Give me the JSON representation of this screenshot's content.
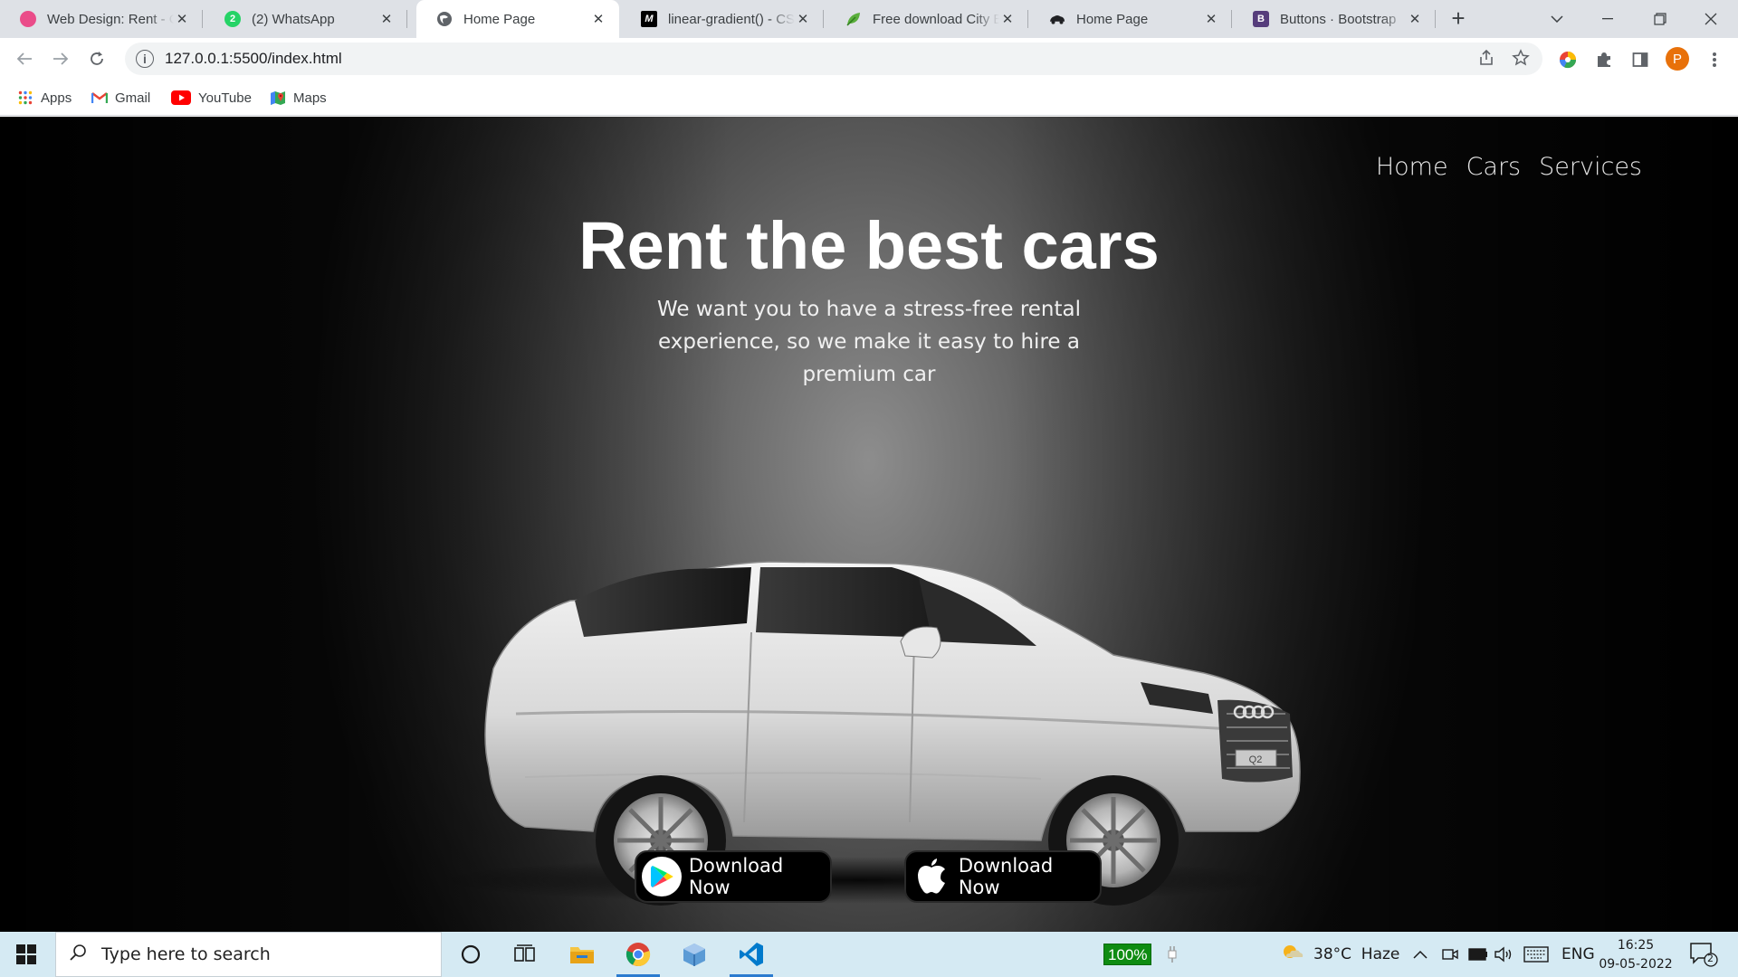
{
  "browser": {
    "tabs": [
      {
        "title": "Web Design: Rent - Car",
        "favicon": "dribbble-icon",
        "color": "#ea4c89"
      },
      {
        "title": "(2) WhatsApp",
        "favicon": "whatsapp-icon",
        "color": "#25d366",
        "badge": "2"
      },
      {
        "title": "Home Page",
        "favicon": "globe-icon",
        "color": "#5f6368",
        "active": true
      },
      {
        "title": "linear-gradient() - CSS",
        "favicon": "mdn-icon",
        "color": "#000000"
      },
      {
        "title": "Free download City Bike",
        "favicon": "leaf-icon",
        "color": "#4caf50"
      },
      {
        "title": "Home Page",
        "favicon": "car-icon",
        "color": "#202124"
      },
      {
        "title": "Buttons · Bootstrap",
        "favicon": "bootstrap-icon",
        "color": "#563d7c",
        "letter": "B"
      }
    ],
    "url": "127.0.0.1:5500/index.html",
    "profile_initial": "P",
    "bookmarks": [
      {
        "label": "Apps",
        "icon": "apps-grid-icon"
      },
      {
        "label": "Gmail",
        "icon": "gmail-icon"
      },
      {
        "label": "YouTube",
        "icon": "youtube-icon"
      },
      {
        "label": "Maps",
        "icon": "maps-icon"
      }
    ]
  },
  "page": {
    "nav": [
      "Home",
      "Cars",
      "Services"
    ],
    "title": "Rent the best cars",
    "subtitle": "We want you to have a stress-free rental experience, so we make it easy to hire a premium car",
    "car_plate": "Q2",
    "buttons": [
      {
        "label": "Download Now",
        "icon": "google-play-icon"
      },
      {
        "label": "Download Now",
        "icon": "apple-icon"
      }
    ]
  },
  "taskbar": {
    "search_placeholder": "Type here to search",
    "battery": "100%",
    "weather": "38°C  Haze",
    "language": "ENG",
    "time": "16:25",
    "date": "09-05-2022",
    "notifications": "2"
  }
}
